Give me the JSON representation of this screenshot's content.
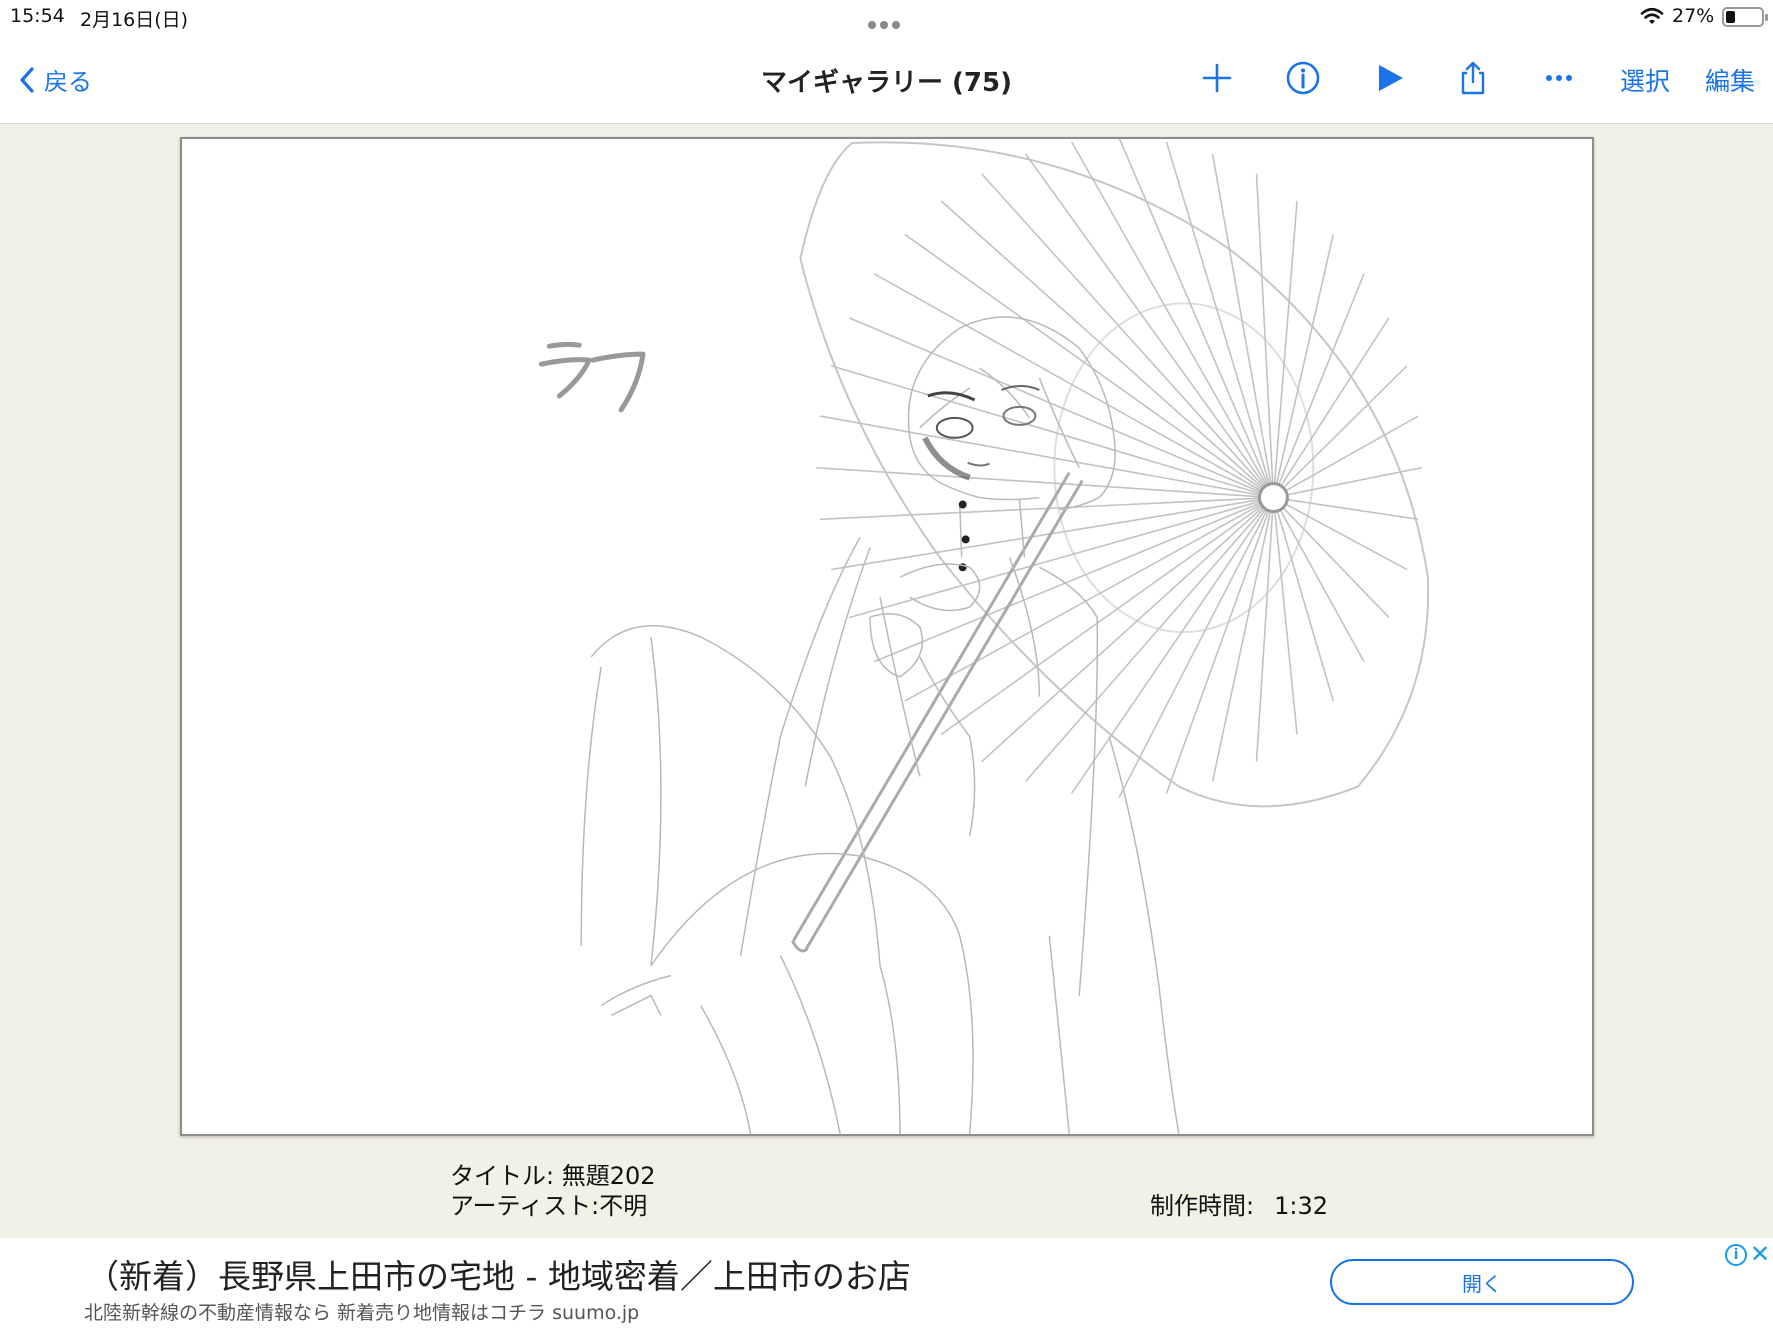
{
  "status_bar": {
    "time": "15:54",
    "date": "2月16日(日)",
    "battery_percent": "27%"
  },
  "nav": {
    "back_label": "戻る",
    "title": "マイギャラリー (75)",
    "select_label": "選択",
    "edit_label": "編集",
    "icons": [
      "plus-icon",
      "info-icon",
      "play-icon",
      "share-icon",
      "more-icon"
    ],
    "accent_color": "#1a73e8"
  },
  "artwork": {
    "handwritten_label": "ラフ"
  },
  "info": {
    "title_text": "タイトル: 無題202",
    "artist_text": "アーティスト:不明",
    "time_label": "制作時間:",
    "time_value": "1:32"
  },
  "ad": {
    "headline": "（新着）長野県上田市の宅地 - 地域密着／上田市のお店",
    "sub": "北陸新幹線の不動産情報なら 新着売り地情報はコチラ suumo.jp",
    "open_label": "開く",
    "info_glyph": "i",
    "close_glyph": "✕"
  }
}
